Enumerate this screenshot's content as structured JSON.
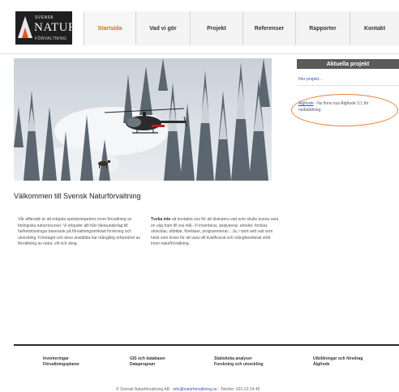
{
  "logo": {
    "line1": "SVENSK",
    "line2": "NATUR",
    "line3": "FÖRVALTNING"
  },
  "nav": {
    "items": [
      {
        "label": "Startsida",
        "active": true
      },
      {
        "label": "Vad vi gör",
        "active": false
      },
      {
        "label": "Projekt",
        "active": false
      },
      {
        "label": "Referenser",
        "active": false
      },
      {
        "label": "Rapporter",
        "active": false
      },
      {
        "label": "Kontakt",
        "active": false
      }
    ]
  },
  "main": {
    "welcome": "Välkommen till Svensk Naturförvaltning",
    "col1": "Vår affärsidé är att erbjuda spetskompetens inom förvaltning av biologiska naturresurser. Vi erbjuder allt från faktaunderlag till helhetslösningar baserade på förvaltningsinriktad forskning och utveckling. Företaget och dess anställda har mångårig erfarenhet av förvaltning av natur, vilt och skog.",
    "col2_bold": "Tveka inte",
    "col2": " att kontakta oss för att diskutera vad som skulle kunna vara en väg fram till era mål. Vi inventerar, analyserar, utreder, forskar, utvecklar, utbildar, föreläser, programmerar... Ja, i stort sett vad som helst som krävs för att vara vill kvalificerat och mångfacetterat stöd inom naturförvaltning."
  },
  "sidebar": {
    "heading": "Aktuella projekt",
    "more": "Fler projekt...",
    "news_link": "Älgfrode",
    "news_text": " - Nu finns nya Älgfrode 3.1 för nedladdning."
  },
  "footer": {
    "cols": [
      {
        "line1": "Inventeringar",
        "line2": "Förvaltningsplaner"
      },
      {
        "line1": "GIS och databaser",
        "line2": "Dataprogram"
      },
      {
        "line1": "Statistiska analyser",
        "line2": "Forskning och utveckling"
      },
      {
        "line1": "Utbildningar och föredrag",
        "line2": "Älgfrode"
      }
    ],
    "copyright_pre": "© Svensk Naturförvaltning AB  -  ",
    "email": "info@naturforvaltning.se",
    "copyright_post": "  -  Telefon: 031-23 24 45"
  },
  "colors": {
    "accent": "#e26a24",
    "link": "#3b4fb5",
    "highlight": "#ee7d33"
  }
}
